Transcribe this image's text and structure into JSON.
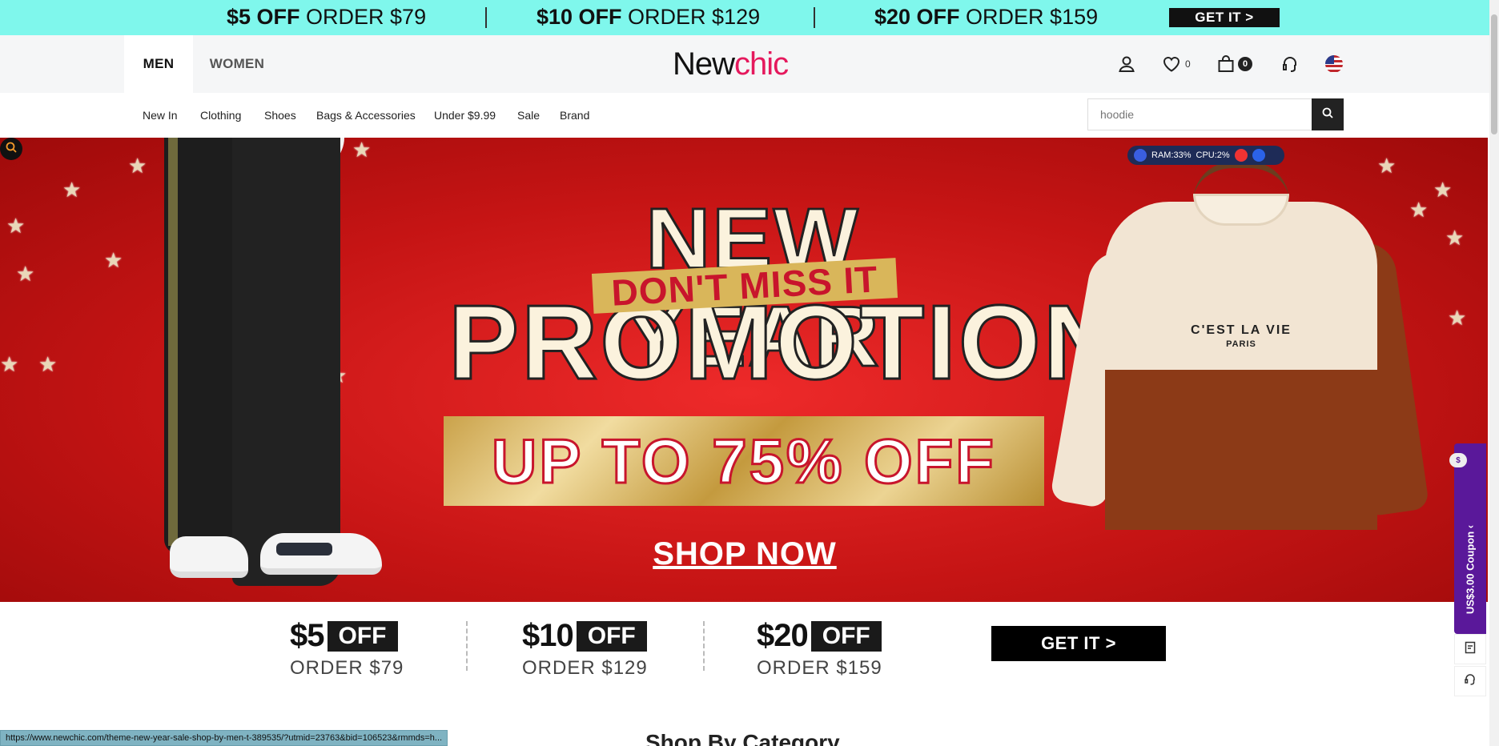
{
  "top_strip": {
    "items": [
      {
        "bold": "$5 OFF",
        "rest": " ORDER $79"
      },
      {
        "bold": "$10 OFF",
        "rest": " ORDER $129"
      },
      {
        "bold": "$20 OFF",
        "rest": " ORDER $159"
      }
    ],
    "button": "GET IT >",
    "bg_color": "#7ff7ec"
  },
  "header": {
    "tabs": [
      "MEN",
      "WOMEN"
    ],
    "logo_part1": "New",
    "logo_part2": "chic",
    "wishlist_count": "0",
    "cart_count": "0",
    "icons": [
      "user-icon",
      "heart-icon",
      "bag-icon",
      "headset-icon",
      "us-flag-icon"
    ]
  },
  "nav": {
    "items": [
      "New In",
      "Clothing",
      "Shoes",
      "Bags & Accessories",
      "Under $9.99",
      "Sale",
      "Brand"
    ],
    "search_placeholder": "hoodie"
  },
  "hero": {
    "title_line1": "NEW YEAR",
    "ribbon": "DON'T MISS IT",
    "title_line2": "PROMOTIONS",
    "offer": "UP TO 75% OFF",
    "cta": "SHOP NOW",
    "sweater_text": "C'EST LA VIE",
    "sweater_sub": "PARIS",
    "ram": "RAM:33%",
    "cpu": "CPU:2%"
  },
  "coupons": {
    "items": [
      {
        "amount": "$5",
        "off": "OFF",
        "order": "ORDER $79"
      },
      {
        "amount": "$10",
        "off": "OFF",
        "order": "ORDER $129"
      },
      {
        "amount": "$20",
        "off": "OFF",
        "order": "ORDER $159"
      }
    ],
    "button": "GET IT >"
  },
  "section_title": "Shop By Category",
  "side": {
    "coupon_label": "US$3.00 Coupon ‹",
    "coupon_badge": "$"
  },
  "status_url": "https://www.newchic.com/theme-new-year-sale-shop-by-men-t-389535/?utmid=23763&bid=106523&rmmds=h..."
}
